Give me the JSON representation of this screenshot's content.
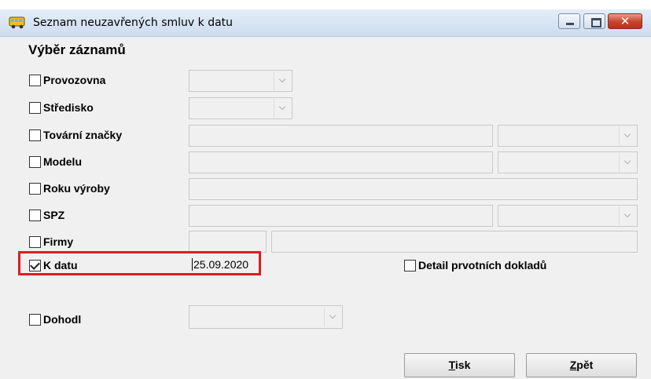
{
  "window": {
    "title": "Seznam neuzavřených smluv k datu",
    "close_symbol": "✕"
  },
  "section_title": "Výběr záznamů",
  "filters": {
    "provozovna": {
      "label": "Provozovna",
      "checked": false
    },
    "stredisko": {
      "label": "Středisko",
      "checked": false
    },
    "tovarni_znacky": {
      "label": "Tovární značky",
      "checked": false
    },
    "modelu": {
      "label": "Modelu",
      "checked": false
    },
    "roku_vyroby": {
      "label": "Roku výroby",
      "checked": false
    },
    "spz": {
      "label": "SPZ",
      "checked": false
    },
    "firmy": {
      "label": "Firmy",
      "checked": false
    },
    "k_datu": {
      "label": "K datu",
      "checked": true,
      "value": "25.09.2020"
    },
    "detail": {
      "label": "Detail prvotních dokladů",
      "checked": false
    },
    "dohodl": {
      "label": "Dohodl",
      "checked": false
    }
  },
  "buttons": {
    "tisk": {
      "accel": "T",
      "rest": "isk"
    },
    "zpet": {
      "accel": "Z",
      "rest": "pět"
    }
  },
  "colors": {
    "highlight": "#e01b22",
    "titlebar": "#d6e3f3",
    "close_button": "#c7432c",
    "background": "#f0f0f0"
  },
  "icons": {
    "app": "bus-icon"
  }
}
